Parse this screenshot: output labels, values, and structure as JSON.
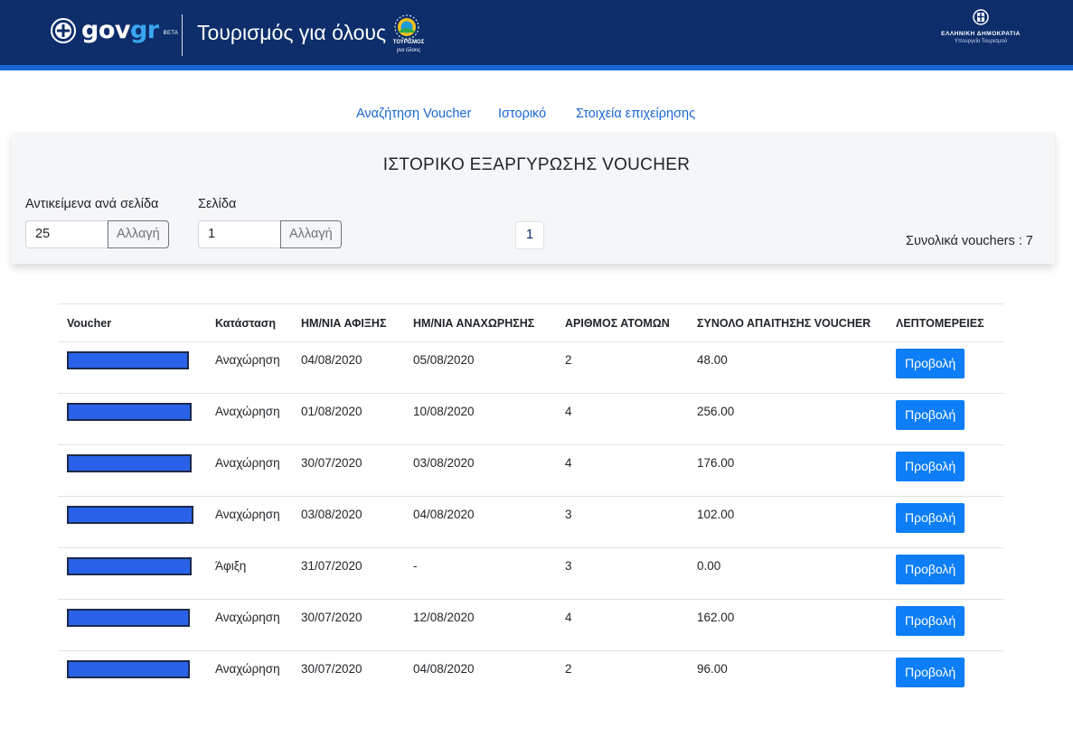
{
  "header": {
    "brand_gov": "gov",
    "brand_gr": "gr",
    "brand_beta": "BETA",
    "title": "Τουρισμός για όλους",
    "tourism_logo_line1": "ΤΟΥΡΙΣΜΟΣ",
    "tourism_logo_line2": "για όλους",
    "republic": "ΕΛΛΗΝΙΚΗ ΔΗΜΟΚΡΑΤΙΑ",
    "ministry": "Υπουργείο Τουρισμού"
  },
  "nav": {
    "items": [
      "Αναζήτηση Voucher",
      "Ιστορικό",
      "Στοιχεία επιχείρησης"
    ]
  },
  "filters": {
    "title": "ΙΣΤΟΡΙΚΟ ΕΞΑΡΓΥΡΩΣΗΣ VOUCHER",
    "per_page_label": "Αντικείμενα ανά σελίδα",
    "per_page_value": "25",
    "page_label": "Σελίδα",
    "page_value": "1",
    "change_label": "Αλλαγή",
    "current_page": "1",
    "total": "Συνολικά vouchers : 7"
  },
  "table": {
    "headers": [
      "Voucher",
      "Κατάσταση",
      "ΗΜ/ΝΙΑ ΑΦΙΞΗΣ",
      "ΗΜ/ΝΙΑ ΑΝΑΧΩΡΗΣΗΣ",
      "ΑΡΙΘΜΟΣ ΑΤΟΜΩΝ",
      "ΣΥΝΟΛΟ ΑΠΑΙΤΗΣΗΣ VOUCHER",
      "ΛΕΠΤΟΜΕΡΕΙΕΣ"
    ],
    "view_label": "Προβολή",
    "rows": [
      {
        "status": "Αναχώρηση",
        "arrival": "04/08/2020",
        "departure": "05/08/2020",
        "persons": "2",
        "total": "48.00"
      },
      {
        "status": "Αναχώρηση",
        "arrival": "01/08/2020",
        "departure": "10/08/2020",
        "persons": "4",
        "total": "256.00"
      },
      {
        "status": "Αναχώρηση",
        "arrival": "30/07/2020",
        "departure": "03/08/2020",
        "persons": "4",
        "total": "176.00"
      },
      {
        "status": "Αναχώρηση",
        "arrival": "03/08/2020",
        "departure": "04/08/2020",
        "persons": "3",
        "total": "102.00"
      },
      {
        "status": "Άφιξη",
        "arrival": "31/07/2020",
        "departure": "-",
        "persons": "3",
        "total": "0.00"
      },
      {
        "status": "Αναχώρηση",
        "arrival": "30/07/2020",
        "departure": "12/08/2020",
        "persons": "4",
        "total": "162.00"
      },
      {
        "status": "Αναχώρηση",
        "arrival": "30/07/2020",
        "departure": "04/08/2020",
        "persons": "2",
        "total": "96.00"
      }
    ]
  },
  "colors": {
    "header_bg": "#0d2e6b",
    "accent": "#1a67d2",
    "button": "#0d7ef5",
    "redaction": "#2962e8"
  }
}
